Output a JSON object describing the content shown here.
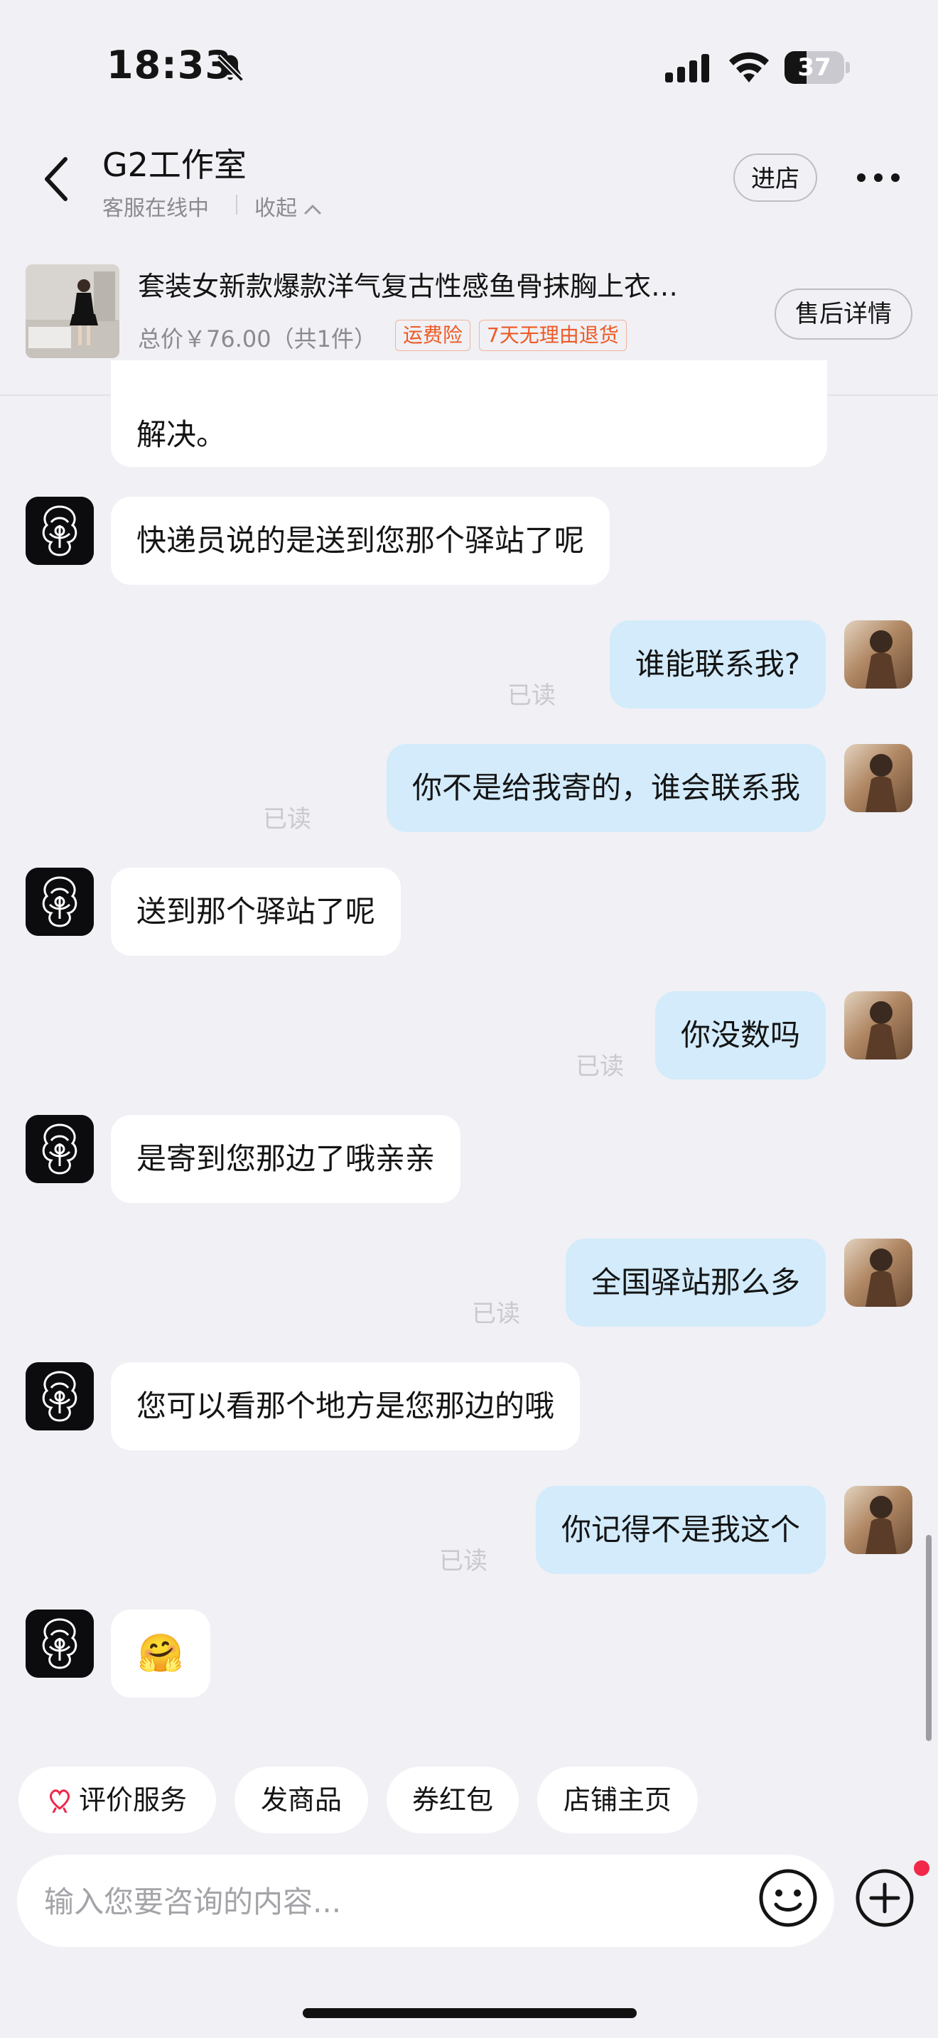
{
  "status_bar": {
    "time": "18:33",
    "battery_level": "37",
    "battery_fraction": 0.37,
    "icons": [
      "bell-muted-icon",
      "signal-icon",
      "wifi-icon",
      "battery-icon"
    ]
  },
  "header": {
    "shop_name": "G2工作室",
    "service_status": "客服在线中",
    "collapse_label": "收起",
    "enter_store_label": "进店",
    "icons": [
      "back-arrow-icon",
      "more-dots-icon",
      "chevron-up-icon"
    ]
  },
  "product": {
    "title": "套装女新款爆款洋气复古性感鱼骨抹胸上衣…",
    "price_text": "总价￥76.00（共1件）",
    "tags": [
      "运费险",
      "7天无理由退货"
    ],
    "after_sale_label": "售后详情"
  },
  "messages": [
    {
      "from": "shop",
      "text": "解决。"
    },
    {
      "from": "shop",
      "text": "快递员说的是送到您那个驿站了呢"
    },
    {
      "from": "user",
      "text": "谁能联系我?",
      "status": "已读"
    },
    {
      "from": "user",
      "text": "你不是给我寄的，谁会联系我",
      "status": "已读"
    },
    {
      "from": "shop",
      "text": "送到那个驿站了呢"
    },
    {
      "from": "user",
      "text": "你没数吗",
      "status": "已读"
    },
    {
      "from": "shop",
      "text": "是寄到您那边了哦亲亲"
    },
    {
      "from": "user",
      "text": "全国驿站那么多",
      "status": "已读"
    },
    {
      "from": "shop",
      "text": "您可以看那个地方是您那边的哦"
    },
    {
      "from": "user",
      "text": "你记得不是我这个",
      "status": "已读"
    },
    {
      "from": "shop",
      "text": "🤗"
    }
  ],
  "quick_actions": [
    "评价服务",
    "发商品",
    "券红包",
    "店铺主页"
  ],
  "input": {
    "placeholder": "输入您要咨询的内容...",
    "value": ""
  },
  "colors": {
    "background": "#f0f0f5",
    "outgoing_bubble": "#d3ebfb",
    "incoming_bubble": "#ffffff",
    "tag_orange": "#ee5a24",
    "notify_red": "#f0284a"
  }
}
